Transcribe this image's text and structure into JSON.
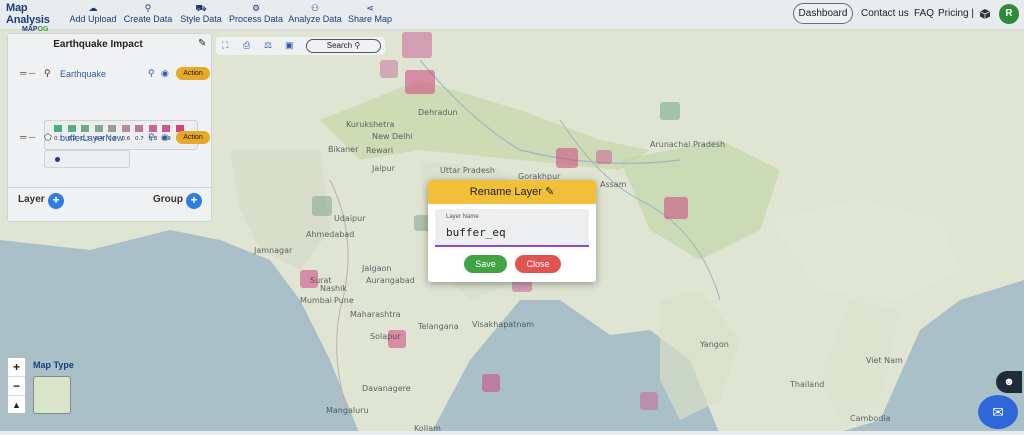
{
  "app": {
    "logo_title": "Map Analysis",
    "logo_sub_a": "MAP",
    "logo_sub_b": "OG"
  },
  "nav": [
    {
      "label": "Add Upload",
      "icon": "cloud-upload-icon",
      "glyph": "☁"
    },
    {
      "label": "Create Data",
      "icon": "location-pin-icon",
      "glyph": "⚲"
    },
    {
      "label": "Style Data",
      "icon": "paint-bucket-icon",
      "glyph": "⛟"
    },
    {
      "label": "Process Data",
      "icon": "process-icon",
      "glyph": "⚙"
    },
    {
      "label": "Analyze Data",
      "icon": "analyze-icon",
      "glyph": "⚇"
    },
    {
      "label": "Share Map",
      "icon": "share-icon",
      "glyph": "⋖"
    }
  ],
  "header_right": {
    "dashboard": "Dashboard",
    "contact": "Contact us",
    "faq": "FAQ",
    "pricing": "Pricing |",
    "avatar_initial": "R"
  },
  "panel": {
    "title": "Earthquake Impact",
    "layers": [
      {
        "name": "Earthquake",
        "action": "Action"
      },
      {
        "name": "bufferLayerNew",
        "action": "Action"
      }
    ],
    "legend": {
      "labels": [
        "0.1",
        "0.2",
        "0.3",
        "0.4",
        "0.5",
        "0.6",
        "0.7",
        "0.8",
        "0.9",
        "1"
      ],
      "colors": [
        "#4caf7a",
        "#5aae7e",
        "#6faa86",
        "#85a68f",
        "#9d9a98",
        "#b58d9c",
        "#c2789a",
        "#c96596",
        "#cf548f",
        "#d0447f"
      ]
    },
    "buffer_color": "#2933a8",
    "layer_label": "Layer",
    "group_label": "Group"
  },
  "toolbar": {
    "search_label": "Search"
  },
  "map_controls": {
    "zoom_in": "+",
    "zoom_out": "−",
    "map_type_label": "Map Type"
  },
  "dialog": {
    "title": "Rename Layer",
    "field_label": "Layer Name",
    "field_value": "buffer_eq",
    "save_label": "Save",
    "close_label": "Close"
  },
  "map_labels": {
    "kurukshetra": "Kurukshetra",
    "new_delhi": "New Delhi",
    "dehradun": "Dehradun",
    "bikaner": "Bikaner",
    "rewari": "Rewari",
    "jaipur": "Jaipur",
    "uttar_pradesh": "Uttar Pradesh",
    "gorakhpur": "Gorakhpur",
    "udaipur": "Udaipur",
    "ahmedabad": "Ahmedabad",
    "jamnagar": "Jamnagar",
    "jalgaon": "Jalgaon",
    "surat": "Surat",
    "aurangabad": "Aurangabad",
    "mumbai": "Mumbai",
    "pune": "Pune",
    "nashik": "Nashik",
    "solapur": "Solapur",
    "visakhapatnam": "Visakhapatnam",
    "davanagere": "Davanagere",
    "mangaluru": "Mangaluru",
    "kollam": "Kollam",
    "telangana": "Telangana",
    "maharashtra": "Maharashtra",
    "yangon": "Yangon",
    "vietnam": "Viet Nam",
    "cambodia": "Cambodia",
    "thailand": "Thailand",
    "assam": "Assam",
    "arunachal": "Arunachal Pradesh"
  }
}
